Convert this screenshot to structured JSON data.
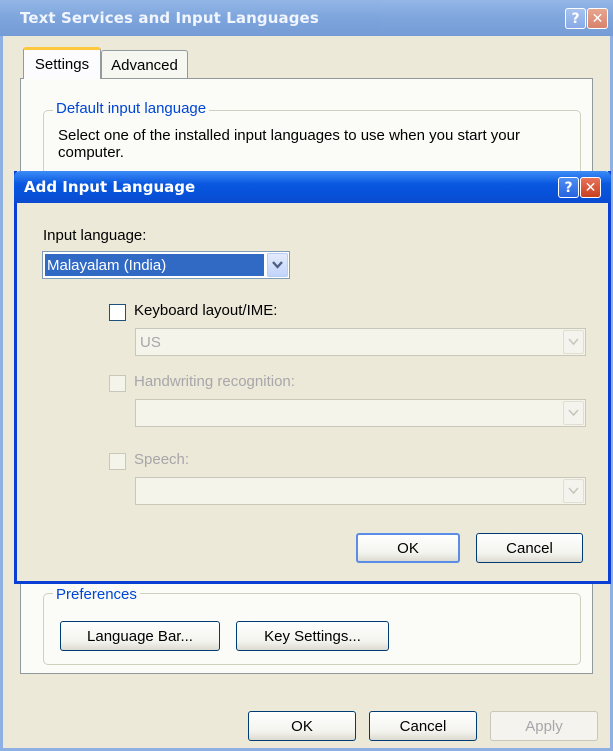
{
  "parent_window": {
    "title": "Text Services and Input Languages",
    "help_label": "?",
    "close_label": "✕",
    "tabs": [
      {
        "label": "Settings"
      },
      {
        "label": "Advanced"
      }
    ],
    "default_group": {
      "legend": "Default input language",
      "description": "Select one of the installed input languages to use when you start your computer."
    },
    "preferences_group": {
      "legend": "Preferences",
      "language_bar_label": "Language Bar...",
      "key_settings_label": "Key Settings..."
    },
    "buttons": {
      "ok": "OK",
      "cancel": "Cancel",
      "apply": "Apply"
    }
  },
  "dialog": {
    "title": "Add Input Language",
    "help_label": "?",
    "close_label": "✕",
    "input_language_label": "Input language:",
    "input_language_value": "Malayalam (India)",
    "keyboard_layout_label": "Keyboard layout/IME:",
    "keyboard_layout_value": "US",
    "handwriting_label": "Handwriting recognition:",
    "handwriting_value": "",
    "speech_label": "Speech:",
    "speech_value": "",
    "ok_label": "OK",
    "cancel_label": "Cancel"
  },
  "icons": {
    "dropdown": "chevron-down-icon",
    "help": "help-icon",
    "close": "close-icon"
  },
  "colors": {
    "dialog_title": "#0a58e0",
    "parent_title_inactive": "#7aa3de",
    "group_legend": "#0046d5",
    "selection": "#316ac5"
  }
}
